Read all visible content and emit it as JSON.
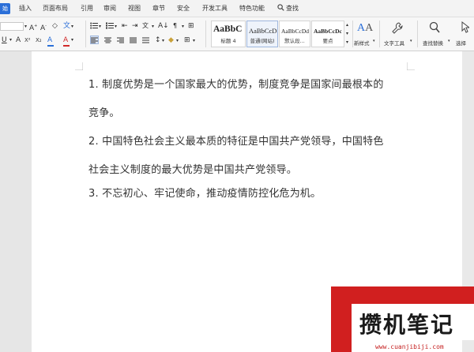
{
  "menu": {
    "start_tab": "始",
    "items": [
      "插入",
      "页面布局",
      "引用",
      "审阅",
      "视图",
      "章节",
      "安全",
      "开发工具",
      "特色功能"
    ],
    "search_label": "查找"
  },
  "ribbon": {
    "styles": [
      {
        "preview": "AaBbC",
        "name": "标题 4"
      },
      {
        "preview": "AaBbCcD",
        "name": "普通(网站)"
      },
      {
        "preview": "AaBbCcDd",
        "name": "默认段..."
      },
      {
        "preview": "AaBbCcDc",
        "name": "要点"
      }
    ],
    "new_style_label": "新样式",
    "text_tools_label": "文字工具",
    "find_replace_label": "查找替换",
    "select_label": "选择"
  },
  "document": {
    "paragraphs": [
      {
        "line1": "1. 制度优势是一个国家最大的优势，制度竞争是国家间最根本的",
        "line2": "竞争。"
      },
      {
        "line1": "2. 中国特色社会主义最本质的特征是中国共产党领导，中国特色",
        "line2": "社会主义制度的最大优势是中国共产党领导。"
      },
      {
        "line1": "3. 不忘初心、牢记使命，推动疫情防控化危为机。",
        "line2": ""
      }
    ]
  },
  "watermark": {
    "logo_text": "攒机笔记",
    "url": "www.cuanjibiji.com",
    "colors": {
      "red": "#d11f1f",
      "dark": "#1a1a1a"
    }
  }
}
